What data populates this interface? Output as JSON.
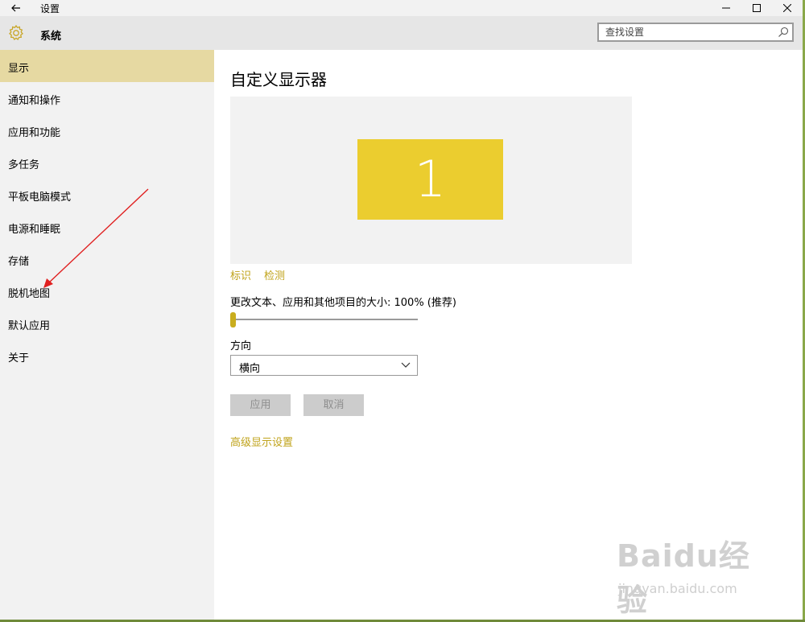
{
  "window": {
    "title": "设置"
  },
  "header": {
    "title": "系统"
  },
  "search": {
    "placeholder": "查找设置"
  },
  "sidebar": {
    "items": [
      {
        "label": "显示",
        "active": true
      },
      {
        "label": "通知和操作"
      },
      {
        "label": "应用和功能"
      },
      {
        "label": "多任务"
      },
      {
        "label": "平板电脑模式"
      },
      {
        "label": "电源和睡眠"
      },
      {
        "label": "存储"
      },
      {
        "label": "脱机地图"
      },
      {
        "label": "默认应用"
      },
      {
        "label": "关于"
      }
    ]
  },
  "main": {
    "title": "自定义显示器",
    "monitor_number": "1",
    "identify_link": "标识",
    "detect_link": "检测",
    "scale_label": "更改文本、应用和其他项目的大小: 100% (推荐)",
    "scale_value_percent": 100,
    "orientation_label": "方向",
    "orientation_value": "横向",
    "apply_button": "应用",
    "cancel_button": "取消",
    "advanced_link": "高级显示设置"
  },
  "watermark": {
    "logo": "Baidu经验",
    "url": "jingyan.baidu.com"
  },
  "colors": {
    "accent": "#c0a31a",
    "monitor": "#ebcd2f",
    "active_nav": "#e6d9a2",
    "annotation_arrow": "#e02020"
  }
}
